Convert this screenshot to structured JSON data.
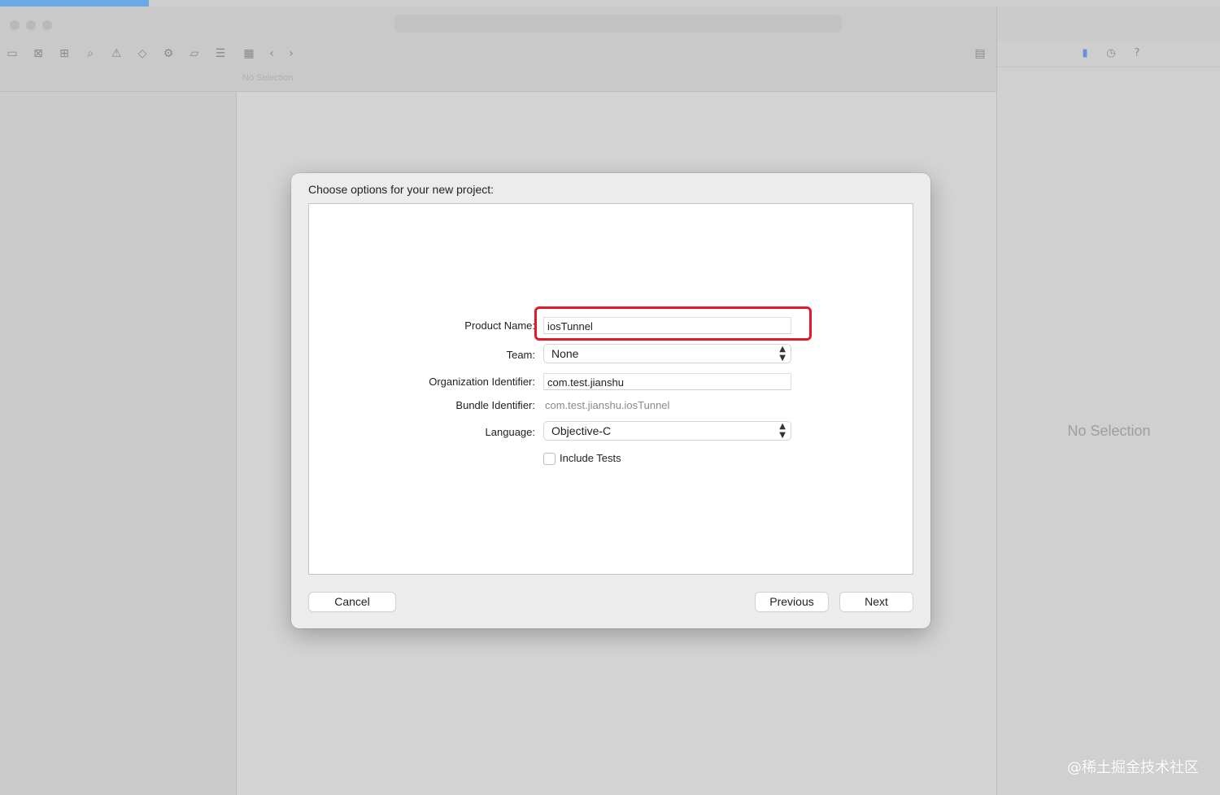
{
  "window": {
    "path_placeholder": "No Selection"
  },
  "dialog": {
    "title": "Choose options for your new project:",
    "fields": {
      "product_name": {
        "label": "Product Name:",
        "value": "iosTunnel"
      },
      "team": {
        "label": "Team:",
        "value": "None"
      },
      "organization_identifier": {
        "label": "Organization Identifier:",
        "value": "com.test.jianshu"
      },
      "bundle_identifier": {
        "label": "Bundle Identifier:",
        "value": "com.test.jianshu.iosTunnel"
      },
      "language": {
        "label": "Language:",
        "value": "Objective-C"
      }
    },
    "include_tests": {
      "label": "Include Tests",
      "checked": false
    },
    "buttons": {
      "cancel": "Cancel",
      "previous": "Previous",
      "next": "Next"
    },
    "highlight_color": "#e0192b"
  },
  "inspector": {
    "empty_text": "No Selection"
  },
  "watermark": "@稀土掘金技术社区",
  "icons": {
    "toolbar": [
      "folder-icon",
      "source-control-icon",
      "hierarchy-icon",
      "search-icon",
      "warning-icon",
      "test-icon",
      "debug-icon",
      "breakpoint-icon",
      "report-icon",
      "grid-icon",
      "back-icon",
      "forward-icon"
    ],
    "inspector": [
      "file-icon",
      "history-icon",
      "help-icon"
    ]
  }
}
